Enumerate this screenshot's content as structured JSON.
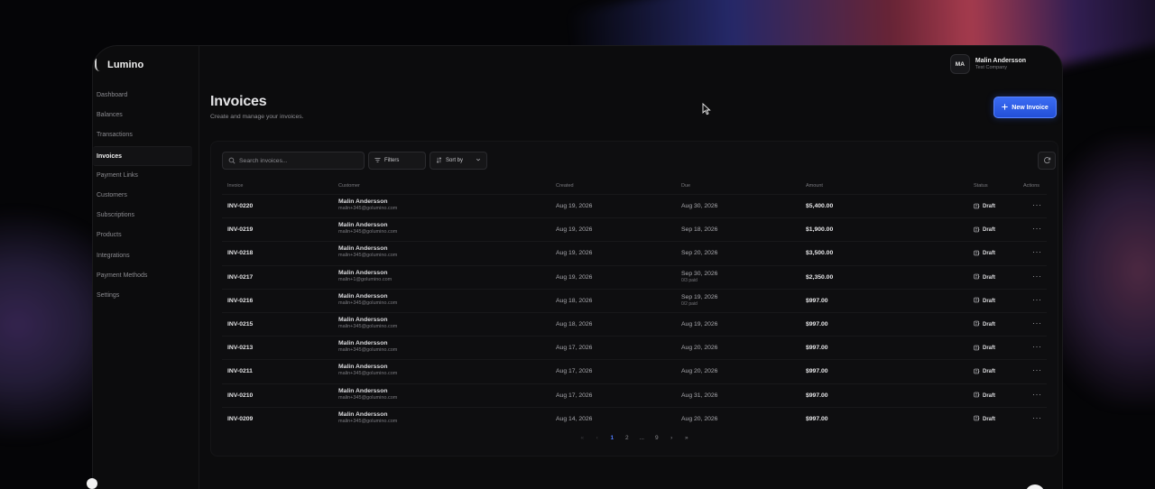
{
  "brand": {
    "name": "Lumino"
  },
  "user": {
    "initials": "MA",
    "name": "Malin Andersson",
    "company": "Test Company"
  },
  "nav": [
    {
      "label": "Dashboard",
      "active": false
    },
    {
      "label": "Balances",
      "active": false
    },
    {
      "label": "Transactions",
      "active": false
    },
    {
      "label": "Invoices",
      "active": true
    },
    {
      "label": "Payment Links",
      "active": false
    },
    {
      "label": "Customers",
      "active": false
    },
    {
      "label": "Subscriptions",
      "active": false
    },
    {
      "label": "Products",
      "active": false
    },
    {
      "label": "Integrations",
      "active": false
    },
    {
      "label": "Payment Methods",
      "active": false
    },
    {
      "label": "Settings",
      "active": false
    }
  ],
  "page": {
    "title": "Invoices",
    "subtitle": "Create and manage your invoices.",
    "new_button": "New Invoice"
  },
  "toolbar": {
    "search_placeholder": "Search invoices...",
    "filters": "Filters",
    "sort": "Sort by"
  },
  "columns": {
    "invoice": "Invoice",
    "customer": "Customer",
    "created": "Created",
    "due": "Due",
    "amount": "Amount",
    "status": "Status",
    "actions": "Actions"
  },
  "rows": [
    {
      "id": "INV-0220",
      "name": "Malin Andersson",
      "email": "malin+345@golumino.com",
      "created": "Aug 19, 2026",
      "due": "Aug 30, 2026",
      "due_note": "",
      "amount": "$5,400.00",
      "status": "Draft"
    },
    {
      "id": "INV-0219",
      "name": "Malin Andersson",
      "email": "malin+345@golumino.com",
      "created": "Aug 19, 2026",
      "due": "Sep 18, 2026",
      "due_note": "",
      "amount": "$1,900.00",
      "status": "Draft"
    },
    {
      "id": "INV-0218",
      "name": "Malin Andersson",
      "email": "malin+345@golumino.com",
      "created": "Aug 19, 2026",
      "due": "Sep 20, 2026",
      "due_note": "",
      "amount": "$3,500.00",
      "status": "Draft"
    },
    {
      "id": "INV-0217",
      "name": "Malin Andersson",
      "email": "malin+1@golumino.com",
      "created": "Aug 19, 2026",
      "due": "Sep 30, 2026",
      "due_note": "0/3 paid",
      "amount": "$2,350.00",
      "status": "Draft"
    },
    {
      "id": "INV-0216",
      "name": "Malin Andersson",
      "email": "malin+345@golumino.com",
      "created": "Aug 18, 2026",
      "due": "Sep 19, 2026",
      "due_note": "0/2 paid",
      "amount": "$997.00",
      "status": "Draft"
    },
    {
      "id": "INV-0215",
      "name": "Malin Andersson",
      "email": "malin+345@golumino.com",
      "created": "Aug 18, 2026",
      "due": "Aug 19, 2026",
      "due_note": "",
      "amount": "$997.00",
      "status": "Draft"
    },
    {
      "id": "INV-0213",
      "name": "Malin Andersson",
      "email": "malin+345@golumino.com",
      "created": "Aug 17, 2026",
      "due": "Aug 20, 2026",
      "due_note": "",
      "amount": "$997.00",
      "status": "Draft"
    },
    {
      "id": "INV-0211",
      "name": "Malin Andersson",
      "email": "malin+345@golumino.com",
      "created": "Aug 17, 2026",
      "due": "Aug 20, 2026",
      "due_note": "",
      "amount": "$997.00",
      "status": "Draft"
    },
    {
      "id": "INV-0210",
      "name": "Malin Andersson",
      "email": "malin+345@golumino.com",
      "created": "Aug 17, 2026",
      "due": "Aug 31, 2026",
      "due_note": "",
      "amount": "$997.00",
      "status": "Draft"
    },
    {
      "id": "INV-0209",
      "name": "Malin Andersson",
      "email": "malin+345@golumino.com",
      "created": "Aug 14, 2026",
      "due": "Aug 20, 2026",
      "due_note": "",
      "amount": "$997.00",
      "status": "Draft"
    }
  ],
  "pagination": {
    "prev": "‹",
    "first_prev": "«",
    "pages": [
      "1",
      "2",
      "...",
      "9"
    ],
    "current": "1",
    "next": "›",
    "last": "»"
  },
  "icons": {
    "search": "search-icon",
    "filter": "filter-icon",
    "sort": "sort-icon",
    "chevron": "chevron-down-icon",
    "refresh": "refresh-icon",
    "status": "draft-icon",
    "more": "more-horizontal-icon",
    "plus": "plus-icon"
  },
  "colors": {
    "accent": "#3b6cf3",
    "page_active": "#4f7cff",
    "background": "#0c0c0d"
  }
}
